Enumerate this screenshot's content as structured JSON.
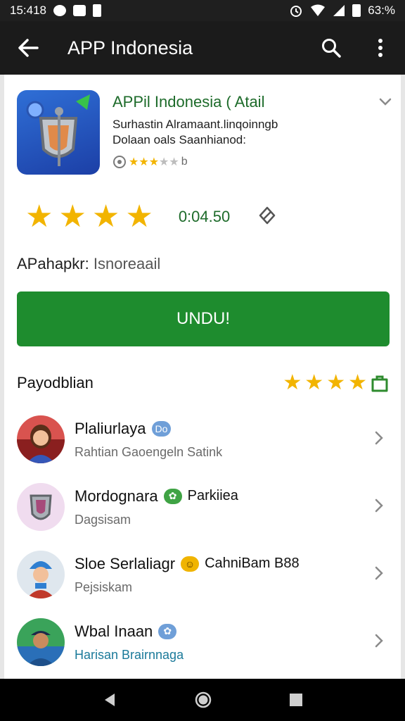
{
  "status_bar": {
    "time": "15:418",
    "battery": "63:%",
    "icons_left": [
      "location-icon",
      "message-icon",
      "sd-card-icon"
    ],
    "icons_right": [
      "alarm-icon",
      "wifi-icon",
      "signal-icon",
      "battery-icon"
    ]
  },
  "app_bar": {
    "title": "APP Indonesia",
    "icons": [
      "back-arrow-icon",
      "search-icon",
      "more-vert-icon"
    ]
  },
  "app": {
    "name": "APPil Indonesia ( Atail",
    "desc_line1": "Surhastin Alramaant.linqoinngb",
    "desc_line2": "Dolaan oals Saanhianod:",
    "mini_rating_suffix": "b",
    "mini_stars_filled": 3,
    "mini_stars_total": 5
  },
  "rating": {
    "stars_filled": 4,
    "value": "0:04.50"
  },
  "info": {
    "label": "APahapkr:",
    "value": "Isnoreaail"
  },
  "install_button": {
    "label": "UNDU!"
  },
  "section": {
    "title": "Payodblian",
    "stars": 4
  },
  "list": [
    {
      "title": "Plaliurlaya",
      "badge": "Do",
      "badge_color": "blue",
      "tail": "",
      "subtitle": "Rahtian Gaoengeln Satink",
      "subtitle_color": "gray",
      "avatar": "avatar-woman"
    },
    {
      "title": "Mordognara",
      "badge": "✿",
      "badge_color": "green",
      "tail": "Parkiiea",
      "subtitle": "Dagsisam",
      "subtitle_color": "gray",
      "avatar": "avatar-shield"
    },
    {
      "title": "Sloe Serlaliagr",
      "badge": "☺",
      "badge_color": "yellow",
      "tail": "CahniBam B88",
      "subtitle": "Pejsiskam",
      "subtitle_color": "gray",
      "avatar": "avatar-man-hat"
    },
    {
      "title": "Wbal Inaan",
      "badge": "✿",
      "badge_color": "blue",
      "tail": "",
      "subtitle": "Harisan Brairnnaga",
      "subtitle_color": "blue",
      "avatar": "avatar-man-cap"
    }
  ],
  "colors": {
    "accent_green": "#1e8c2e",
    "star_yellow": "#f2b400",
    "title_green": "#1d6b2a",
    "app_bar": "#1b1b1b"
  }
}
